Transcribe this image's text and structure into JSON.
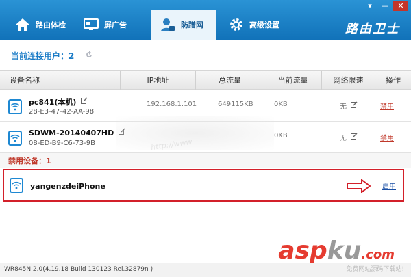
{
  "window": {
    "min": "▾",
    "max": "—",
    "close": "✕"
  },
  "tabs": [
    {
      "label": "路由体检",
      "icon": "home-icon"
    },
    {
      "label": "屏广告",
      "icon": "monitor-icon"
    },
    {
      "label": "防蹭网",
      "icon": "user-lock-icon",
      "active": true
    },
    {
      "label": "高级设置",
      "icon": "gear-icon"
    }
  ],
  "brand": "路由卫士",
  "connected": {
    "label": "当前连接用户：",
    "count": "2",
    "refresh_icon": "refresh-icon"
  },
  "columns": [
    "设备名称",
    "IP地址",
    "总流量",
    "当前流量",
    "网络限速",
    "操作"
  ],
  "devices": [
    {
      "name": "pc841(本机)",
      "mac": "28-E3-47-42-AA-98",
      "ip": "192.168.1.101",
      "total": "649115KB",
      "current": "0KB",
      "limit": "无",
      "action": "禁用"
    },
    {
      "name": "SDWM-20140407HD",
      "mac": "08-ED-B9-C6-73-9B",
      "ip": "",
      "total": "",
      "current": "0KB",
      "limit": "无",
      "action": "禁用"
    }
  ],
  "banned": {
    "label": "禁用设备：1",
    "device": {
      "name": "yangenzdeiPhone",
      "action": "启用"
    }
  },
  "watermark": "http://www",
  "version": "WR845N 2.0(4.19.18 Build 130123 Rel.32879n )",
  "aspku": {
    "part1": "asp",
    "part2": "ku",
    "tld": ".com",
    "sub": "免费网站源码下载站!"
  },
  "colors": {
    "topbar": "#1a80c4",
    "accent": "#1a7bc6",
    "danger": "#c0392b",
    "highlight_border": "#d3202a"
  }
}
